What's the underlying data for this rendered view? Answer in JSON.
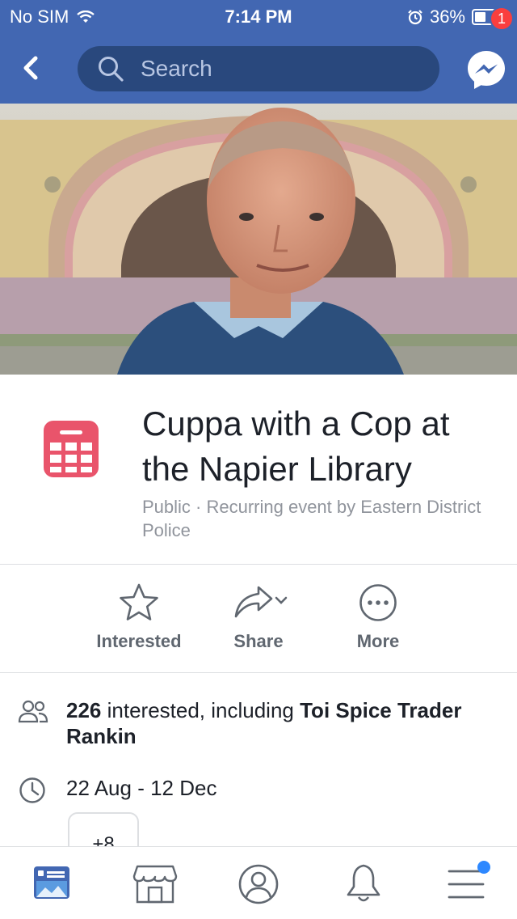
{
  "status_bar": {
    "carrier": "No SIM",
    "time": "7:14 PM",
    "battery_text": "36%",
    "battery_level": 0.36
  },
  "nav": {
    "search_placeholder": "Search",
    "messenger_badge": "1"
  },
  "event": {
    "title": "Cuppa with a Cop at the Napier Library",
    "subtitle": "Public · Recurring event by Eastern District Police"
  },
  "actions": [
    {
      "label": "Interested",
      "icon": "star-icon"
    },
    {
      "label": "Share",
      "icon": "share-icon"
    },
    {
      "label": "More",
      "icon": "more-icon"
    }
  ],
  "details": {
    "interested_count": "226",
    "interested_text": " interested, including ",
    "interested_names": "Toi Spice Trader Rankin",
    "date_range": "22 Aug - 12 Dec",
    "more_dates_label": "+8"
  },
  "colors": {
    "brand": "#4267b2",
    "search_bg": "#29487d",
    "badge": "#fa3e3e",
    "calendar": "#e9546b",
    "tab_active": "#4267b2",
    "notification_dot": "#2d88ff"
  },
  "tabs": [
    {
      "icon": "news-feed-icon",
      "active": true
    },
    {
      "icon": "marketplace-icon",
      "active": false
    },
    {
      "icon": "profile-icon",
      "active": false
    },
    {
      "icon": "notifications-icon",
      "active": false
    },
    {
      "icon": "menu-icon",
      "active": false
    }
  ]
}
